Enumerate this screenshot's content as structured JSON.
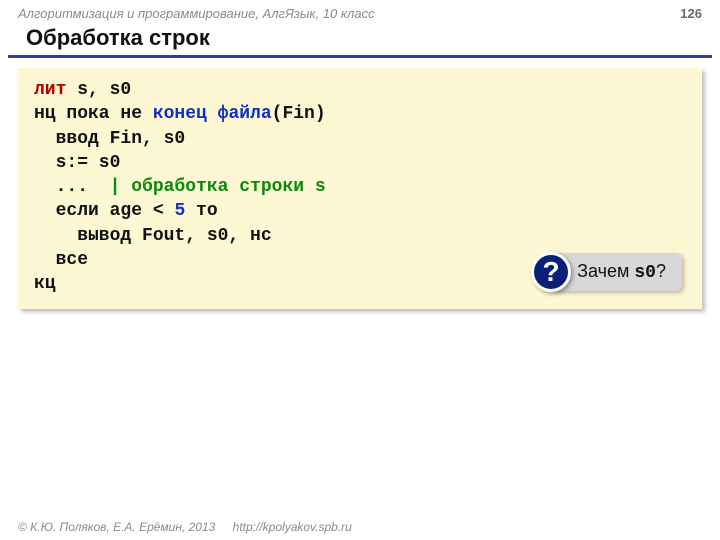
{
  "header": {
    "course": "Алгоритмизация и программирование, АлгЯзык, 10 класс",
    "page": "126"
  },
  "title": "Обработка строк",
  "code": {
    "l1_kw": "лит",
    "l1_rest": " s, s0",
    "l2_a": "нц пока не ",
    "l2_b": "конец файла",
    "l2_c": "(Fin)",
    "l3": "  ввод Fin, s0",
    "l4": "  s:= s0",
    "l5_a": "  ...  ",
    "l5_b": "| обработка строки s",
    "l6_a": "  если age < ",
    "l6_b": "5",
    "l6_c": " то",
    "l7": "    вывод Fout, s0, нс",
    "l8": "  все",
    "l9": "кц"
  },
  "callout": {
    "mark": "?",
    "text_pre": "Зачем ",
    "text_mono": "s0",
    "text_post": "?"
  },
  "footer": {
    "copyright": "© К.Ю. Поляков, Е.А. Ерёмин, 2013",
    "url": "http://kpolyakov.spb.ru"
  }
}
